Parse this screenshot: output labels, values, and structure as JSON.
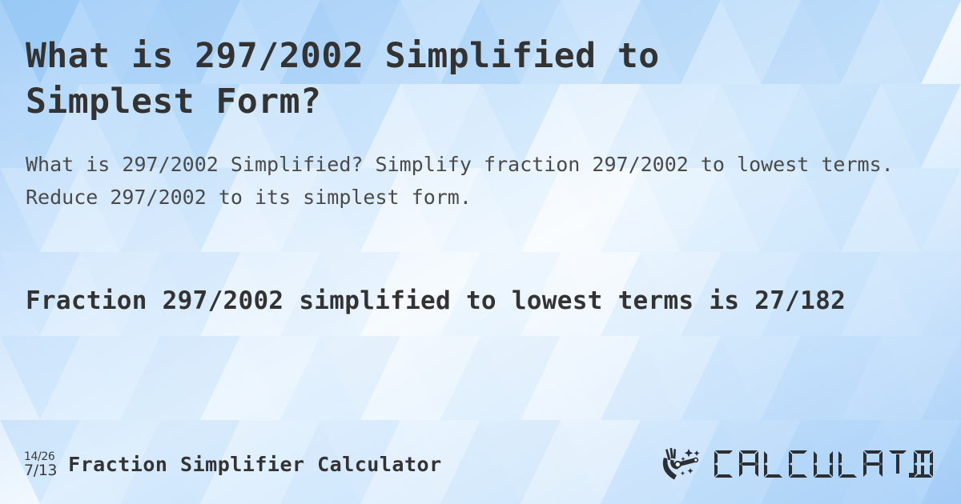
{
  "page": {
    "title": "What is 297/2002 Simplified to Simplest Form?",
    "description": "What is 297/2002 Simplified? Simplify fraction 297/2002 to lowest terms. Reduce 297/2002 to its simplest form.",
    "result": "Fraction 297/2002 simplified to lowest terms is 27/182"
  },
  "fraction": {
    "numerator": "297",
    "denominator": "2002",
    "simplified_numerator": "27",
    "simplified_denominator": "182",
    "original": "297/2002",
    "simplified": "27/182"
  },
  "footer": {
    "icon": {
      "name": "fraction-reduce-icon",
      "top": "14/26",
      "bottom": "7/13"
    },
    "tool_name": "Fraction Simplifier Calculator",
    "brand": {
      "icon_name": "magic-wand-hand-icon",
      "text": "CALCULAT.IO"
    }
  },
  "colors": {
    "background_light": "#f4fafe",
    "background_mid": "#cfe4fb",
    "background_deep": "#a3cdf6",
    "text_primary": "#333333",
    "text_secondary": "#4a4a4a",
    "brand_dark": "#2b2f33"
  }
}
